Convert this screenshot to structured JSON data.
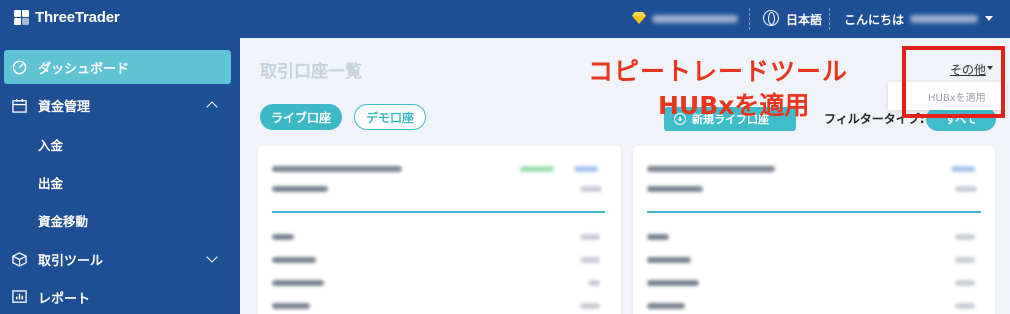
{
  "header": {
    "brand": "ThreeTrader",
    "language": "日本語",
    "greeting": "こんにちは"
  },
  "sidebar": {
    "items": [
      {
        "label": "ダッシュボード",
        "icon": "gauge-icon",
        "active": true
      },
      {
        "label": "資金管理",
        "icon": "calendar-icon",
        "expanded": true
      },
      {
        "label": "入金"
      },
      {
        "label": "出金"
      },
      {
        "label": "資金移動"
      },
      {
        "label": "取引ツール",
        "icon": "cube-icon",
        "expanded": false
      },
      {
        "label": "レポート",
        "icon": "report-icon"
      }
    ]
  },
  "main": {
    "title": "取引口座一覧",
    "tabs": [
      {
        "label": "ライブ口座",
        "selected": true
      },
      {
        "label": "デモ口座",
        "selected": false
      }
    ],
    "new_account_button": "新規ライブ口座",
    "filter_label": "フィルタータイプ:",
    "filter_value": "すべて",
    "more_link": "その他",
    "more_menu_item": "HUBxを適用"
  },
  "annotation": {
    "line1": "コピートレードツール",
    "line2": "HUBxを適用",
    "color": "#e8361e",
    "box_color": "#e5201b"
  },
  "colors": {
    "header_bg": "#1e4f95",
    "accent": "#3db8c6",
    "active_nav": "#5fc3d3"
  }
}
